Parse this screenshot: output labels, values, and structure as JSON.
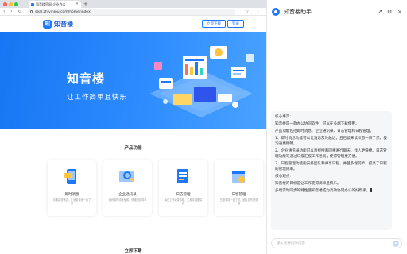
{
  "browser": {
    "tab_title": "知音楼官网-企业办公",
    "tab_close": "×",
    "new_tab": "+",
    "address": "seal.zhiyinlou.com/home/index",
    "back": "‹",
    "forward": "›",
    "reload": "↻",
    "star": "☆",
    "menu": "⋮"
  },
  "site": {
    "logo_mark": "知",
    "logo": "知音楼",
    "download_btn": "立即下载",
    "login_btn": "登录",
    "hero_title": "知音楼",
    "hero_subtitle": "让工作简单且快乐",
    "products_title": "产品功能",
    "cards": [
      {
        "title": "即时消息",
        "desc": "沟通高效畅达，让消息传递一目了然"
      },
      {
        "title": "企业通讯录",
        "desc": "组织架构清晰呈现，快速找到同事"
      },
      {
        "title": "日志管理",
        "desc": "每日工作记录清晰，汇报沟通更高效"
      },
      {
        "title": "日程管理",
        "desc": "日程安排一目了然，团队协作更便捷"
      }
    ],
    "download_title": "立即下载"
  },
  "assistant": {
    "title": "知音楼助手",
    "share_icon": "↗",
    "settings_icon": "⚙",
    "close_icon": "×",
    "message": [
      "核心事实:",
      "知音楼是一款办公协同软件，可以在多端下载使用。",
      "产品功能包括即时消息、企业通讯录、日志管理和日程管理。",
      "1、即时消息功能可以让消息及时触达，且已读未读状态一目了然，使沟通更顺畅。",
      "2、企业通讯录功能可以直接搜索同事进行聊天，找人更快捷。日志管理功能可通过日报汇报工作进展，使得管理更方便。",
      "3、日程管理功能能安排团队和共享日程，并且多端同步，提高了日程的管理效率。",
      "核心观点:",
      "知音楼的目标是让工作变得简单且快乐。",
      "多端实时同步的特性使知音楼成为高效协同办公的好帮手。"
    ],
    "input_placeholder": "输入您想问的内容...",
    "send_icon": "➤"
  },
  "colors": {
    "brand": "#1e78ff",
    "hero_start": "#1676f3",
    "hero_end": "#4aa3ff"
  }
}
